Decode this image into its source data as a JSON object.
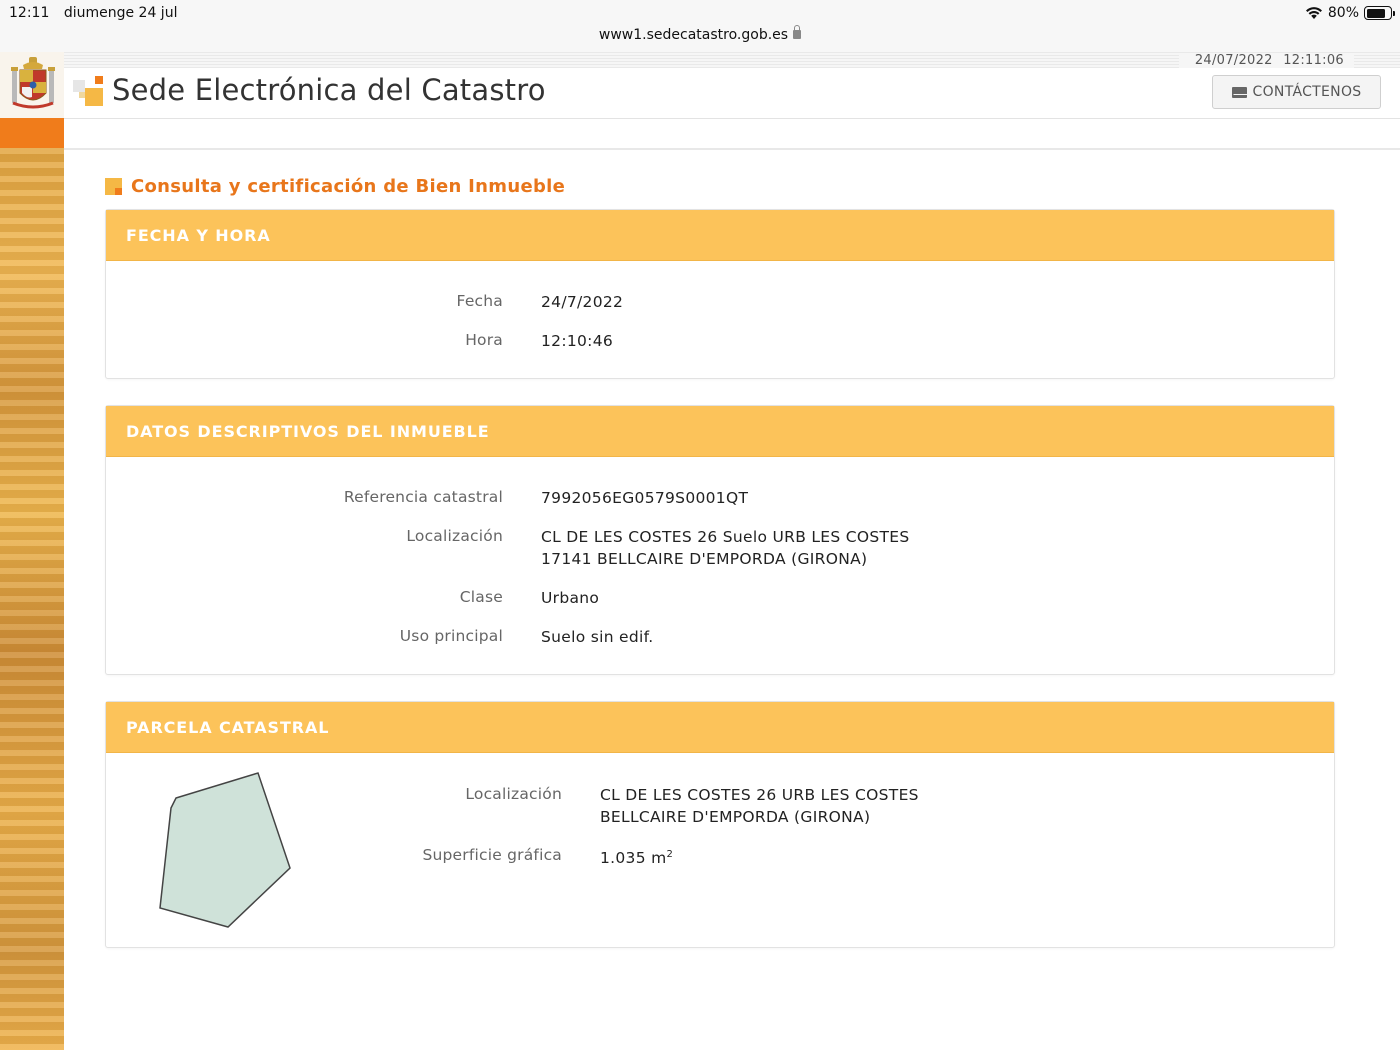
{
  "status": {
    "time": "12:11",
    "date": "diumenge 24 jul",
    "battery": "80%",
    "battery_level": 0.8,
    "url": "www1.sedecatastro.gob.es"
  },
  "header": {
    "timestamp_date": "24/07/2022",
    "timestamp_time": "12:11:06",
    "site_title": "Sede Electrónica del Catastro",
    "contact_label": "CONTÁCTENOS"
  },
  "page": {
    "title": "Consulta y certificación de Bien Inmueble"
  },
  "fecha_hora": {
    "heading": "FECHA Y HORA",
    "fecha_label": "Fecha",
    "fecha_value": "24/7/2022",
    "hora_label": "Hora",
    "hora_value": "12:10:46"
  },
  "datos": {
    "heading": "DATOS DESCRIPTIVOS DEL INMUEBLE",
    "ref_label": "Referencia catastral",
    "ref_value": "7992056EG0579S0001QT",
    "loc_label": "Localización",
    "loc_line1": "CL DE LES COSTES 26 Suelo URB LES COSTES",
    "loc_line2": "17141 BELLCAIRE D'EMPORDA (GIRONA)",
    "clase_label": "Clase",
    "clase_value": "Urbano",
    "uso_label": "Uso principal",
    "uso_value": "Suelo sin edif."
  },
  "parcela": {
    "heading": "PARCELA CATASTRAL",
    "loc_label": "Localización",
    "loc_line1": "CL DE LES COSTES 26 URB LES COSTES",
    "loc_line2": "BELLCAIRE D'EMPORDA (GIRONA)",
    "sup_label": "Superficie gráfica",
    "sup_value": "1.035 m",
    "sup_unit_exp": "2",
    "shape_color": "#cfe2d9"
  },
  "colors": {
    "accent_orange": "#e8761b",
    "panel_header": "#fcc35a"
  }
}
